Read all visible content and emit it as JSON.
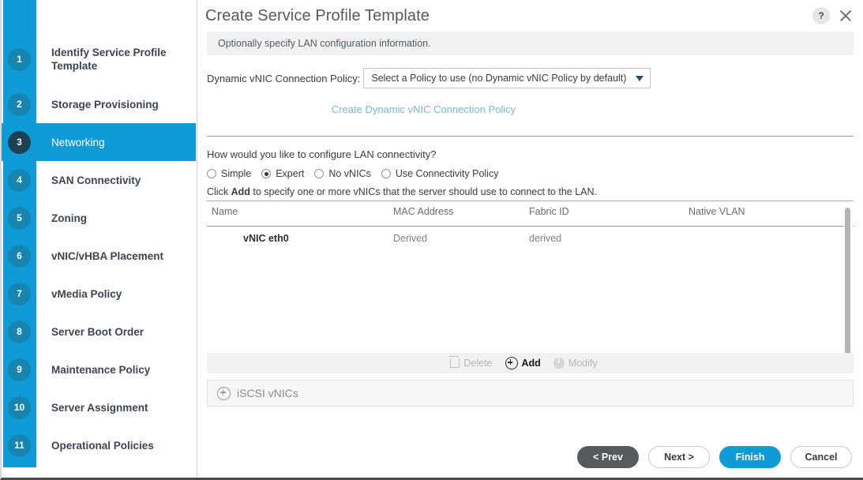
{
  "dialog": {
    "title": "Create Service Profile Template",
    "subtitle": "Optionally specify LAN configuration information.",
    "help_label": "?",
    "close_label": "✕"
  },
  "sidebar": {
    "steps": [
      {
        "num": "1",
        "label": "Identify Service Profile Template",
        "active": false
      },
      {
        "num": "2",
        "label": "Storage Provisioning",
        "active": false
      },
      {
        "num": "3",
        "label": "Networking",
        "active": true
      },
      {
        "num": "4",
        "label": "SAN Connectivity",
        "active": false
      },
      {
        "num": "5",
        "label": "Zoning",
        "active": false
      },
      {
        "num": "6",
        "label": "vNIC/vHBA Placement",
        "active": false
      },
      {
        "num": "7",
        "label": "vMedia Policy",
        "active": false
      },
      {
        "num": "8",
        "label": "Server Boot Order",
        "active": false
      },
      {
        "num": "9",
        "label": "Maintenance Policy",
        "active": false
      },
      {
        "num": "10",
        "label": "Server Assignment",
        "active": false
      },
      {
        "num": "11",
        "label": "Operational Policies",
        "active": false
      }
    ]
  },
  "dynamic_policy": {
    "label": "Dynamic vNIC Connection Policy:",
    "selected": "Select a Policy to use (no Dynamic vNIC Policy by default)",
    "create_link": "Create Dynamic vNIC Connection Policy"
  },
  "lan": {
    "question": "How would you like to configure LAN connectivity?",
    "options": [
      {
        "label": "Simple",
        "selected": false
      },
      {
        "label": "Expert",
        "selected": true
      },
      {
        "label": "No vNICs",
        "selected": false
      },
      {
        "label": "Use Connectivity Policy",
        "selected": false
      }
    ],
    "hint_prefix": "Click ",
    "hint_bold": "Add",
    "hint_suffix": " to specify one or more vNICs that the server should use to connect to the LAN."
  },
  "table": {
    "columns": [
      "Name",
      "MAC Address",
      "Fabric ID",
      "Native VLAN"
    ],
    "rows": [
      {
        "name": "vNIC eth0",
        "mac": "Derived",
        "fabric": "derived",
        "vlan": ""
      }
    ],
    "toolbar": {
      "delete_label": "Delete",
      "add_label": "Add",
      "modify_label": "Modify"
    }
  },
  "iscsi": {
    "label": "iSCSI vNICs"
  },
  "footer": {
    "prev": "< Prev",
    "next": "Next >",
    "finish": "Finish",
    "cancel": "Cancel"
  },
  "colors": {
    "accent_blue": "#0f9bd7",
    "dark_step": "#1d4150",
    "prev_grey": "#58595b",
    "link_blue": "#7cb6d8"
  }
}
